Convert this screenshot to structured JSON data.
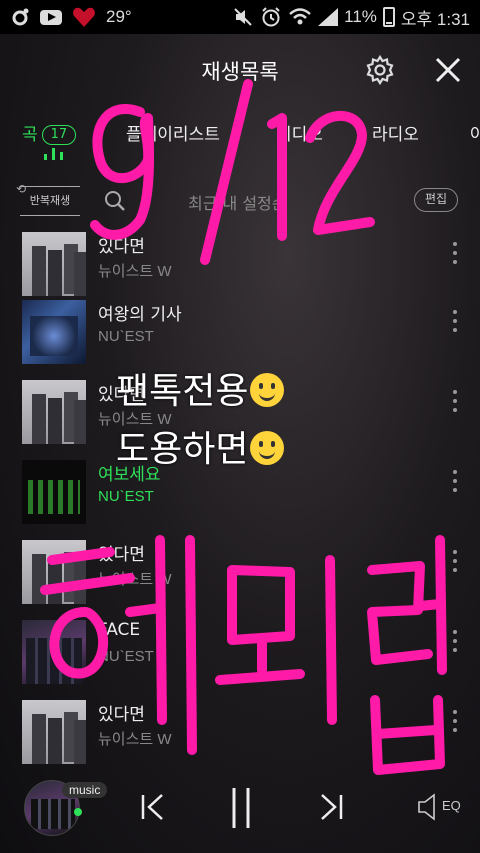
{
  "status_bar": {
    "temperature": "29°",
    "battery": "11%",
    "time": "오후 1:31"
  },
  "header": {
    "title": "재생목록"
  },
  "tabs": [
    {
      "label": "곡",
      "badge": "17",
      "active": true
    },
    {
      "label": "플레이리스트",
      "active": false
    },
    {
      "label": "비디오",
      "active": false
    },
    {
      "label": "라디오",
      "active": false
    },
    {
      "label": "아",
      "active": false
    }
  ],
  "controls": {
    "repeat_label": "반복재생",
    "sort_label": "최근 내 설정순",
    "edit_label": "편집"
  },
  "songs": [
    {
      "title": "있다면",
      "artist": "뉴이스트 W",
      "art": "grey"
    },
    {
      "title": "여왕의 기사",
      "artist": "NU`EST",
      "art": "blue"
    },
    {
      "title": "있다면",
      "artist": "뉴이스트 W",
      "art": "grey"
    },
    {
      "title": "여보세요",
      "artist": "NU`EST",
      "art": "green",
      "playing": true
    },
    {
      "title": "있다면",
      "artist": "뉴이스트 W",
      "art": "grey"
    },
    {
      "title": "FACE",
      "artist": "NU`EST",
      "art": "dark"
    },
    {
      "title": "있다면",
      "artist": "뉴이스트 W",
      "art": "grey"
    }
  ],
  "player": {
    "tag": "music",
    "eq_label": "EQ"
  },
  "overlay": {
    "date": "9/12",
    "line1": "팬톡전용",
    "line2": "도용하면",
    "line3": "해뫼럽",
    "ink_color": "#ff1aa8"
  },
  "colors": {
    "accent": "#2fe05a",
    "background": "#1e1b1e"
  }
}
